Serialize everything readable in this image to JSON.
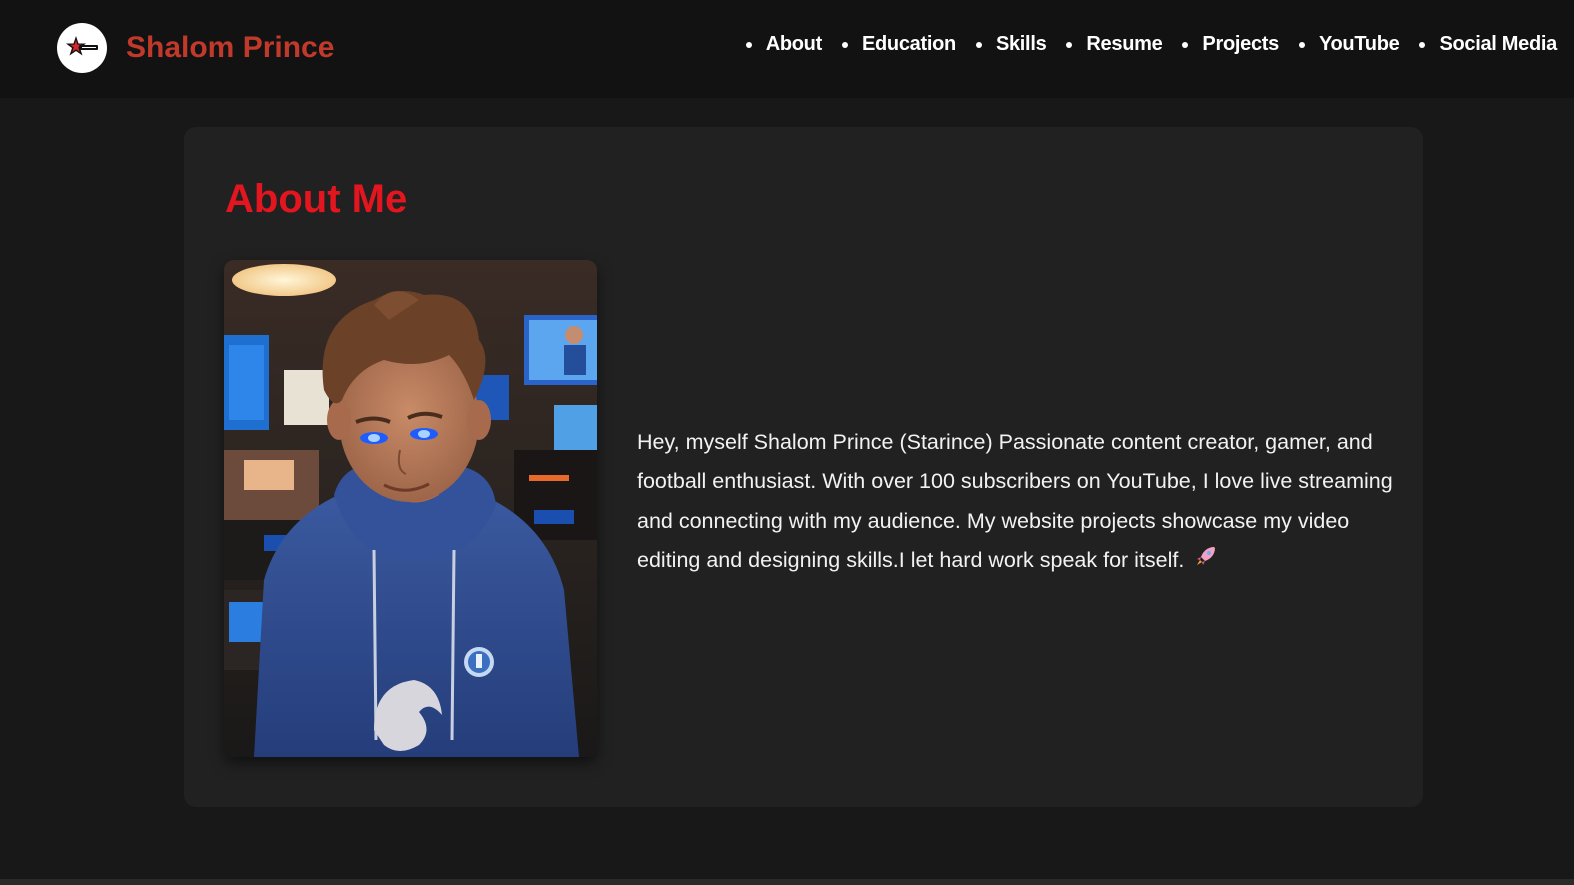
{
  "brand": {
    "name": "Shalom Prince",
    "logo_icon": "starince-logo-icon"
  },
  "nav": {
    "items": [
      {
        "label": "About"
      },
      {
        "label": "Education"
      },
      {
        "label": "Skills"
      },
      {
        "label": "Resume"
      },
      {
        "label": "Projects"
      },
      {
        "label": "YouTube"
      },
      {
        "label": "Social Media"
      }
    ]
  },
  "about": {
    "title": "About Me",
    "bio": "Hey, myself Shalom Prince (Starince) Passionate content creator, gamer, and football enthusiast. With over 100 subscribers on YouTube, I love live streaming and connecting with my audience. My website projects showcase my video editing and designing skills.I let hard work speak for itself.",
    "emoji_icon": "rocket-icon"
  },
  "colors": {
    "brand": "#c0392b",
    "heading": "#e3161f",
    "background": "#181818",
    "card": "#212121"
  }
}
